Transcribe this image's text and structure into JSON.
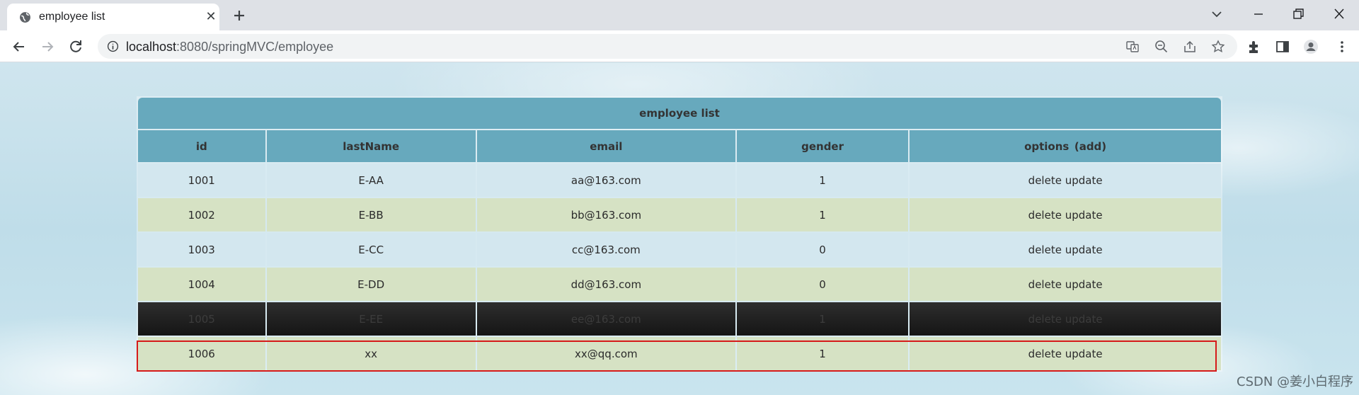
{
  "browser": {
    "tab_title": "employee list",
    "tab_close": "✕",
    "url_host": "localhost",
    "url_rest": ":8080/springMVC/employee"
  },
  "table": {
    "caption": "employee list",
    "headers": [
      "id",
      "lastName",
      "email",
      "gender",
      "options (add)"
    ],
    "rows": [
      {
        "id": "1001",
        "lastName": "E-AA",
        "email": "aa@163.com",
        "gender": "1",
        "options": "delete update"
      },
      {
        "id": "1002",
        "lastName": "E-BB",
        "email": "bb@163.com",
        "gender": "1",
        "options": "delete update"
      },
      {
        "id": "1003",
        "lastName": "E-CC",
        "email": "cc@163.com",
        "gender": "0",
        "options": "delete update"
      },
      {
        "id": "1004",
        "lastName": "E-DD",
        "email": "dd@163.com",
        "gender": "0",
        "options": "delete update"
      },
      {
        "id": "1005",
        "lastName": "E-EE",
        "email": "ee@163.com",
        "gender": "1",
        "options": "delete update"
      },
      {
        "id": "1006",
        "lastName": "xx",
        "email": "xx@qq.com",
        "gender": "1",
        "options": "delete update"
      }
    ]
  },
  "watermark": "CSDN @姜小白程序",
  "colors": {
    "header": "#67a9bd",
    "row_blue": "#d3e7ef",
    "row_green": "#d6e2c4",
    "highlight_border": "#d61a1a"
  }
}
